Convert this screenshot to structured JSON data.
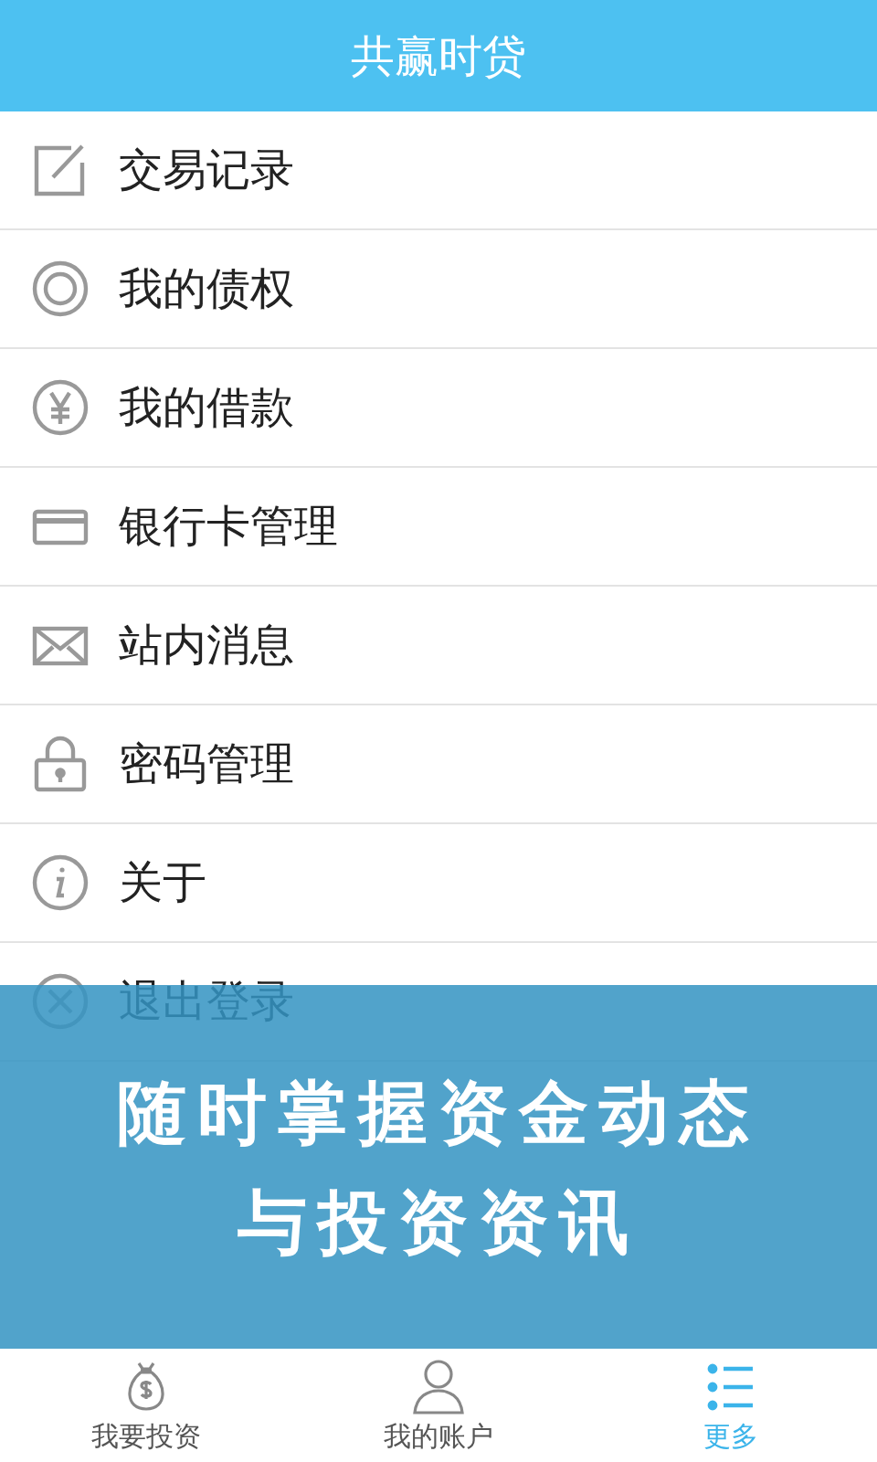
{
  "header": {
    "title": "共赢时贷"
  },
  "menu": [
    {
      "label": "交易记录",
      "kind": "edit"
    },
    {
      "label": "我的债权",
      "kind": "ring"
    },
    {
      "label": "我的借款",
      "kind": "yen"
    },
    {
      "label": "银行卡管理",
      "kind": "card"
    },
    {
      "label": "站内消息",
      "kind": "mail"
    },
    {
      "label": "密码管理",
      "kind": "lock"
    },
    {
      "label": "关于",
      "kind": "info"
    },
    {
      "label": "退出登录",
      "kind": "close"
    }
  ],
  "banner": {
    "lines": [
      "随时掌握资金动态",
      "与投资资讯"
    ]
  },
  "tabs": [
    {
      "label": "我要投资",
      "kind": "money",
      "selected": false
    },
    {
      "label": "我的账户",
      "kind": "user",
      "selected": false
    },
    {
      "label": "更多",
      "kind": "list",
      "selected": true
    }
  ]
}
